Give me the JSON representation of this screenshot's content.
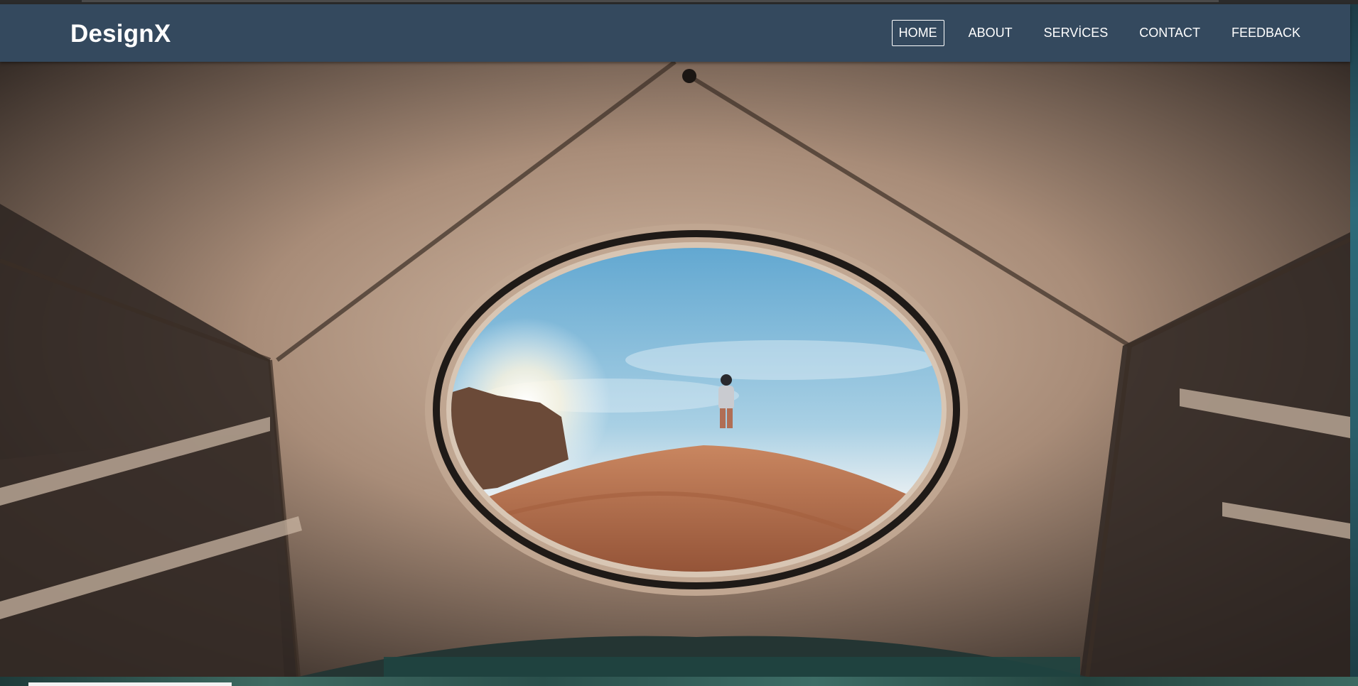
{
  "brand": {
    "name": "DesignX"
  },
  "nav": {
    "items": [
      {
        "label": "HOME",
        "active": true
      },
      {
        "label": "ABOUT",
        "active": false
      },
      {
        "label": "SERVİCES",
        "active": false
      },
      {
        "label": "CONTACT",
        "active": false
      },
      {
        "label": "FEEDBACK",
        "active": false
      }
    ]
  },
  "hero": {
    "image": "tent-view-desert-hiker-image"
  },
  "colors": {
    "navbar_bg": "#34495e",
    "nav_text": "#ffffff",
    "tent_fabric": "#b59a86",
    "sky": "#7fb8d8",
    "sand": "#b5704a"
  }
}
